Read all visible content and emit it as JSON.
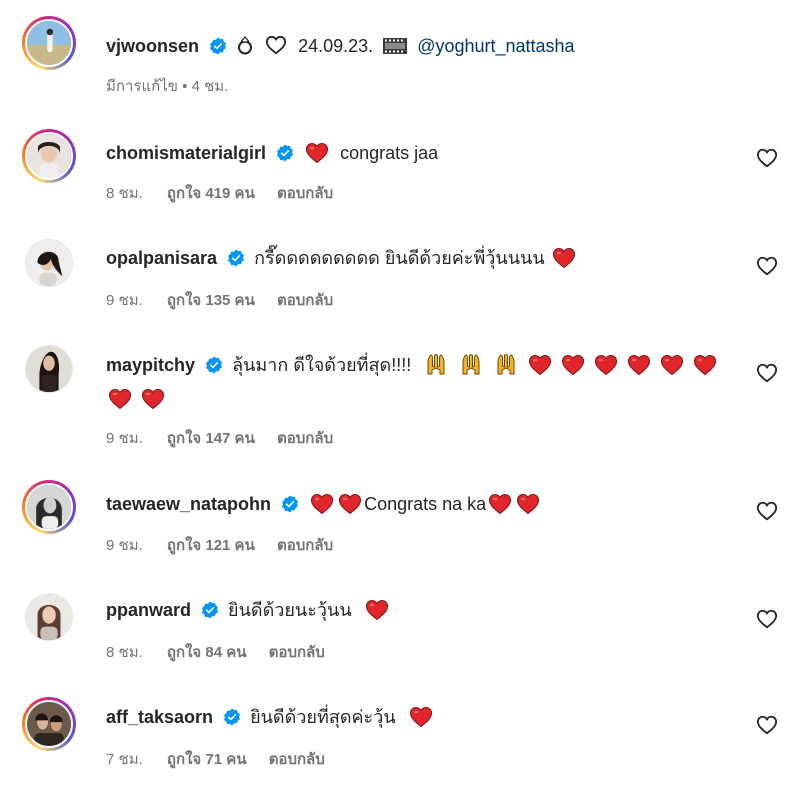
{
  "post": {
    "username": "vjwoonsen",
    "date_text": "24.09.23.",
    "mention": "@yoghurt_nattasha",
    "meta": "มีการแก้ไข • 4 ชม."
  },
  "labels": {
    "reply": "ตอบกลับ"
  },
  "comments": [
    {
      "username": "chomismaterialgirl",
      "text": "congrats jaa",
      "time": "8 ชม.",
      "likes": "ถูกใจ 419 คน"
    },
    {
      "username": "opalpanisara",
      "text": "กรี๊ดดดดดดดดด ยินดีด้วยค่ะพี่วุ้นนนน",
      "time": "9 ชม.",
      "likes": "ถูกใจ 135 คน"
    },
    {
      "username": "maypitchy",
      "text": "ลุ้นมาก ดีใจด้วยที่สุด!!!!",
      "time": "9 ชม.",
      "likes": "ถูกใจ 147 คน"
    },
    {
      "username": "taewaew_natapohn",
      "text": "Congrats na ka",
      "time": "9 ชม.",
      "likes": "ถูกใจ 121 คน"
    },
    {
      "username": "ppanward",
      "text": "ยินดีด้วยนะวุ้นน",
      "time": "8 ชม.",
      "likes": "ถูกใจ 84 คน"
    },
    {
      "username": "aff_taksaorn",
      "text": "ยินดีด้วยที่สุดค่ะวุ้น",
      "time": "7 ชม.",
      "likes": "ถูกใจ 71 คน"
    }
  ],
  "colors": {
    "verified": "#0095f6",
    "heart_red": "#e0262b",
    "mention": "#00376b"
  }
}
